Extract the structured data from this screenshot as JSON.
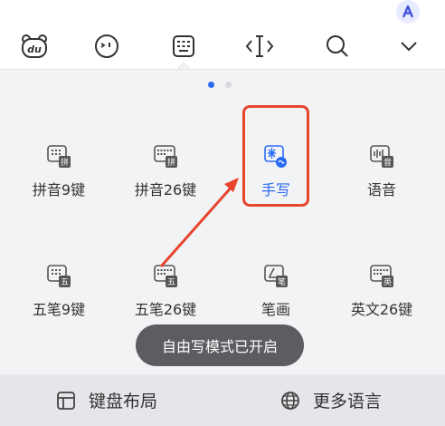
{
  "toolbar": {
    "icons": [
      "du-logo-icon",
      "emoji-face-icon",
      "keyboard-icon",
      "cursor-move-icon",
      "search-icon",
      "chevron-down-icon"
    ],
    "avatar_letter": "A"
  },
  "pager": {
    "active_page": 1,
    "total_pages": 2
  },
  "layouts": [
    {
      "label": "拼音9键",
      "badge": "拼"
    },
    {
      "label": "拼音26键",
      "badge": "拼"
    },
    {
      "label": "手写",
      "badge": ""
    },
    {
      "label": "语音",
      "badge": "音"
    },
    {
      "label": "五笔9键",
      "badge": "五"
    },
    {
      "label": "五笔26键",
      "badge": "五"
    },
    {
      "label": "笔画",
      "badge": "笔"
    },
    {
      "label": "英文26键",
      "badge": "英"
    }
  ],
  "selected_layout": "手写",
  "toast": {
    "text": "自由写模式已开启"
  },
  "bottom_bar": {
    "layout_label": "键盘布局",
    "languages_label": "更多语言"
  },
  "colors": {
    "accent": "#2b6bf3",
    "highlight": "#e8452f",
    "toast_bg": "#5b5d61"
  }
}
